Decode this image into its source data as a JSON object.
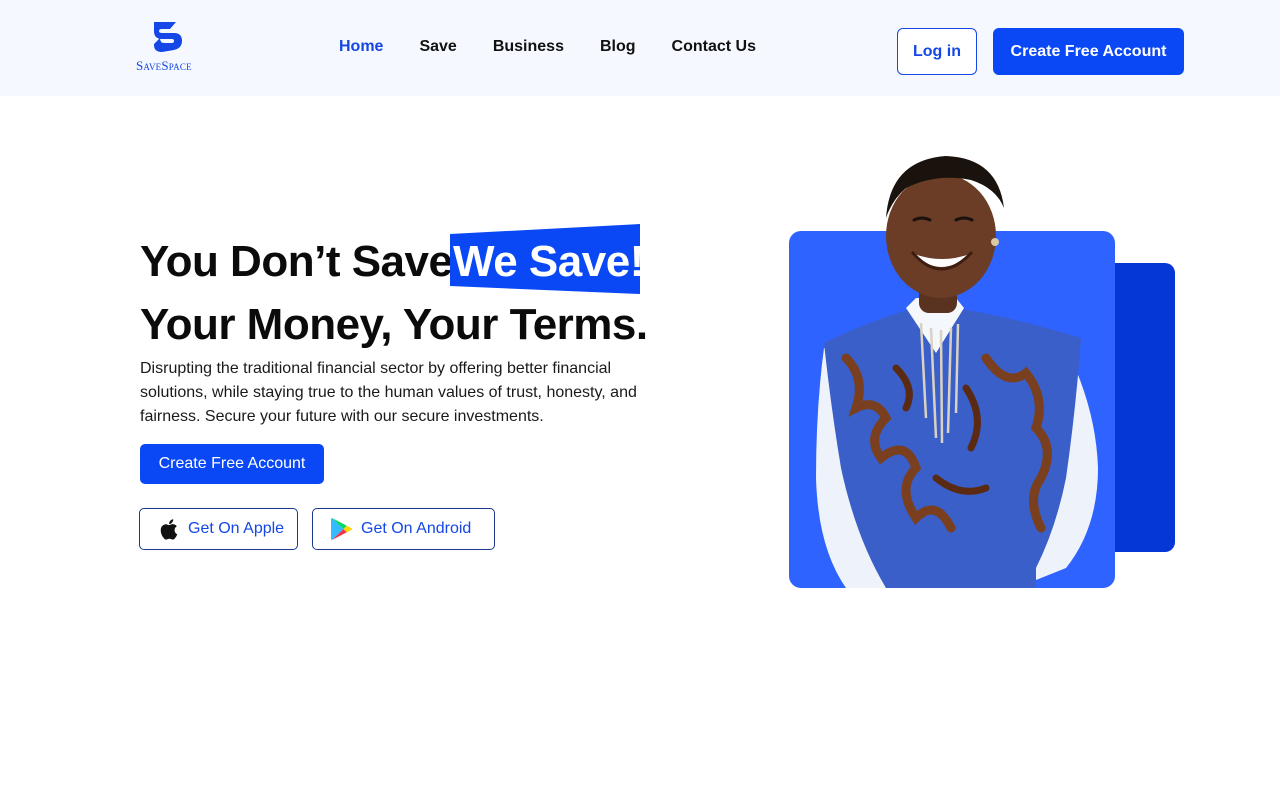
{
  "brand": {
    "name": "SaveSpace",
    "primary_color": "#0a48f5",
    "dark_blue": "#0537d6",
    "panel_blue": "#2f63ff"
  },
  "nav": {
    "items": [
      {
        "label": "Home",
        "active": true
      },
      {
        "label": "Save",
        "active": false
      },
      {
        "label": "Business",
        "active": false
      },
      {
        "label": "Blog",
        "active": false
      },
      {
        "label": "Contact Us",
        "active": false
      }
    ]
  },
  "header_actions": {
    "login_label": "Log in",
    "create_label": "Create Free Account"
  },
  "hero": {
    "headline_part1": "You Don’t Save,",
    "headline_highlight": "We Save!",
    "headline_line2": "Your Money, Your Terms.",
    "description": "Disrupting the traditional financial sector by offering better financial solutions, while staying true to the human values of trust, honesty, and fairness. Secure your future with our secure investments.",
    "cta_label": "Create Free Account",
    "apple_label": "Get On Apple",
    "android_label": "Get On Android"
  },
  "icons": {
    "logo": "savespace-s-logo-icon",
    "apple": "apple-icon",
    "android": "google-play-icon"
  }
}
